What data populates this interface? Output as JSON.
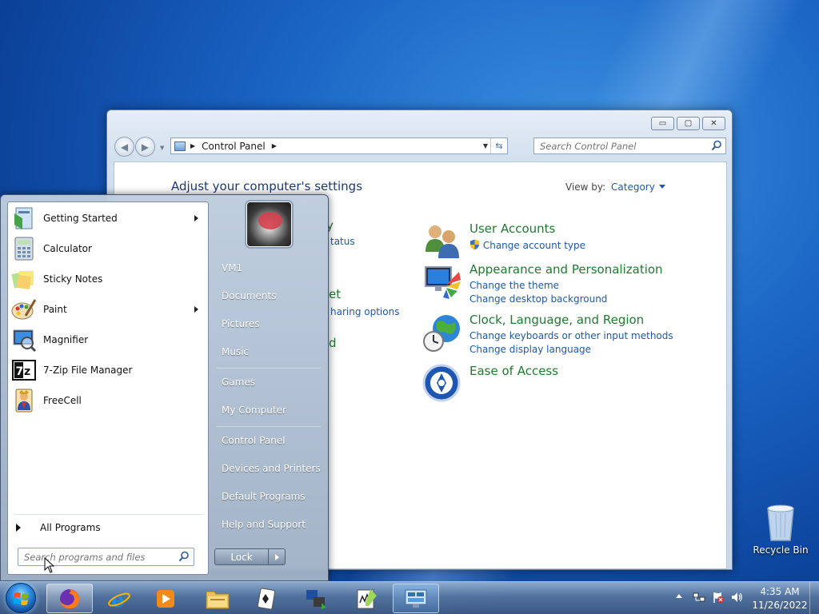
{
  "control_panel": {
    "window_controls": {
      "minimize": "▭",
      "maximize": "▢",
      "close": "✕"
    },
    "breadcrumb": "Control Panel",
    "search_placeholder": "Search Control Panel",
    "heading": "Adjust your computer's settings",
    "view_by_label": "View by:",
    "view_by_value": "Category",
    "hidden_fragments": {
      "partial_1": "y",
      "partial_1_link": "tatus",
      "partial_2": "et",
      "partial_2_link": "haring options",
      "partial_3": "d"
    },
    "categories": [
      {
        "title": "User Accounts",
        "links": [
          "Change account type"
        ],
        "icon": "user-accounts-icon"
      },
      {
        "title": "Appearance and Personalization",
        "links": [
          "Change the theme",
          "Change desktop background"
        ],
        "icon": "appearance-icon"
      },
      {
        "title": "Clock, Language, and Region",
        "links": [
          "Change keyboards or other input methods",
          "Change display language"
        ],
        "icon": "clock-globe-icon"
      },
      {
        "title": "Ease of Access",
        "links": [],
        "icon": "ease-of-access-icon"
      }
    ]
  },
  "start_menu": {
    "programs": [
      {
        "label": "Getting Started",
        "has_submenu": true,
        "icon": "getting-started-icon"
      },
      {
        "label": "Calculator",
        "has_submenu": false,
        "icon": "calculator-icon"
      },
      {
        "label": "Sticky Notes",
        "has_submenu": false,
        "icon": "sticky-notes-icon"
      },
      {
        "label": "Paint",
        "has_submenu": true,
        "icon": "paint-icon"
      },
      {
        "label": "Magnifier",
        "has_submenu": false,
        "icon": "magnifier-icon"
      },
      {
        "label": "7-Zip File Manager",
        "has_submenu": false,
        "icon": "7zip-icon"
      },
      {
        "label": "FreeCell",
        "has_submenu": false,
        "icon": "freecell-icon"
      }
    ],
    "all_programs": "All Programs",
    "search_placeholder": "Search programs and files",
    "right_items": [
      "VM1",
      "Documents",
      "Pictures",
      "Music",
      "Games",
      "My Computer",
      "Control Panel",
      "Devices and Printers",
      "Default Programs",
      "Help and Support"
    ],
    "lock_label": "Lock"
  },
  "desktop": {
    "recycle_bin": "Recycle Bin"
  },
  "taskbar": {
    "apps": [
      "firefox",
      "internet-explorer",
      "media-player",
      "file-explorer",
      "solitaire",
      "network-tool",
      "notepad-plus",
      "control-panel"
    ],
    "clock_time": "4:35 AM",
    "clock_date": "11/26/2022"
  }
}
